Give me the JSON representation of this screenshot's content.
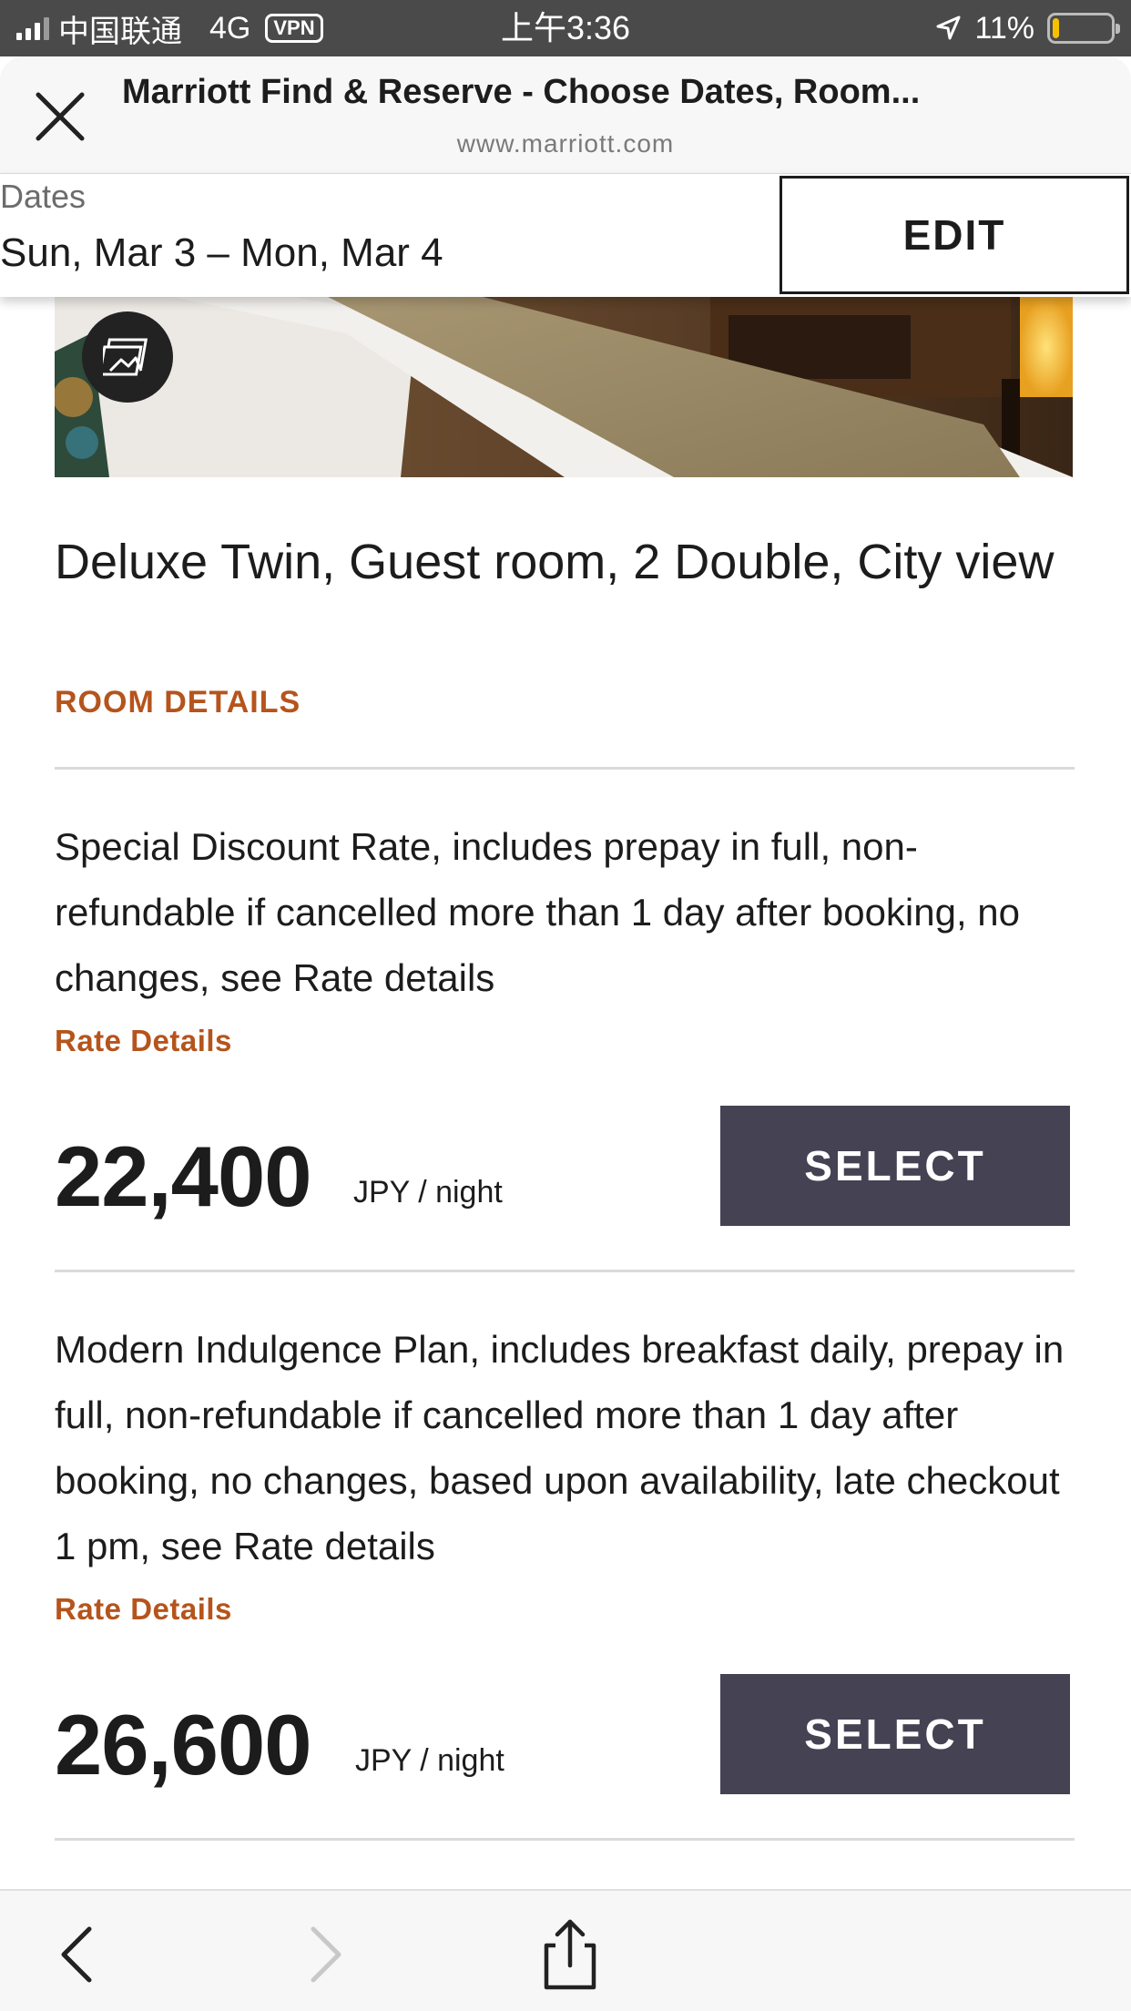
{
  "status_bar": {
    "carrier": "中国联通",
    "network": "4G",
    "vpn": "VPN",
    "time": "上午3:36",
    "battery": "11%",
    "battery_level": 0.11
  },
  "browser": {
    "title": "Marriott Find & Reserve - Choose Dates, Room...",
    "url": "www.marriott.com"
  },
  "dates": {
    "label": "Dates",
    "value": "Sun, Mar 3 – Mon, Mar 4",
    "edit_label": "EDIT"
  },
  "room": {
    "title": "Deluxe Twin, Guest room, 2 Double, City view",
    "details_link": "ROOM DETAILS"
  },
  "rates": [
    {
      "description": "Special Discount Rate, includes prepay in full, non-refundable if cancelled more than 1 day after booking, no changes, see Rate details",
      "details_link": "Rate Details",
      "price": "22,400",
      "unit": "JPY / night",
      "select_label": "SELECT"
    },
    {
      "description": "Modern Indulgence Plan, includes breakfast daily, prepay in full, non-refundable if cancelled more than 1 day after booking, no changes, based upon availability, late checkout 1 pm, see Rate details",
      "details_link": "Rate Details",
      "price": "26,600",
      "unit": "JPY / night",
      "select_label": "SELECT"
    }
  ],
  "icons": {
    "close": "close-icon",
    "gallery": "gallery-icon",
    "back": "back-icon",
    "forward": "forward-icon",
    "share": "share-icon",
    "location": "location-arrow-icon"
  },
  "colors": {
    "accent": "#b5541c",
    "button": "#454253",
    "status_bar": "#4a4a4a"
  }
}
